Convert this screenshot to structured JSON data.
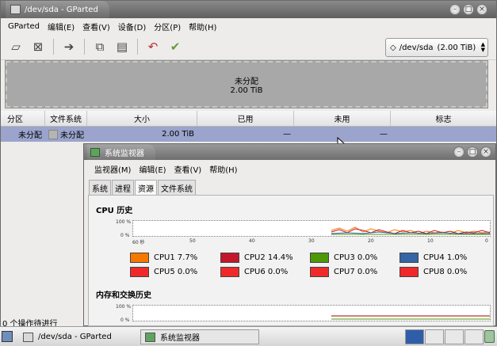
{
  "gparted": {
    "title": "/dev/sda - GParted",
    "menu": [
      "GParted",
      "编辑(E)",
      "查看(V)",
      "设备(D)",
      "分区(P)",
      "帮助(H)"
    ],
    "device_label": "/dev/sda",
    "device_size": "(2.00 TiB)",
    "map_label": "未分配",
    "map_size": "2.00 TiB",
    "columns": [
      "分区",
      "文件系统",
      "大小",
      "已用",
      "未用",
      "标志"
    ],
    "row": {
      "partition": "未分配",
      "filesystem": "未分配",
      "size": "2.00 TiB",
      "used": "—",
      "unused": "—",
      "flags": ""
    },
    "status": "0 个操作待进行"
  },
  "sysmon": {
    "title": "系统监视器",
    "menu": [
      "监视器(M)",
      "编辑(E)",
      "查看(V)",
      "帮助(H)"
    ],
    "tabs": [
      "系统",
      "进程",
      "资源",
      "文件系统"
    ],
    "active_tab": "资源",
    "cpu_heading": "CPU 历史",
    "mem_heading": "内存和交换历史",
    "y_labels": [
      "100 %",
      "0 %"
    ],
    "x_labels": [
      "60 秒",
      "50",
      "40",
      "30",
      "20",
      "10",
      "0"
    ],
    "cpus": [
      {
        "label": "CPU1",
        "value": "7.7%",
        "color": "#f57900"
      },
      {
        "label": "CPU2",
        "value": "14.4%",
        "color": "#c4172c"
      },
      {
        "label": "CPU3",
        "value": "0.0%",
        "color": "#4e9a06"
      },
      {
        "label": "CPU4",
        "value": "1.0%",
        "color": "#3465a4"
      },
      {
        "label": "CPU5",
        "value": "0.0%",
        "color": "#ef2929"
      },
      {
        "label": "CPU6",
        "value": "0.0%",
        "color": "#ef2929"
      },
      {
        "label": "CPU7",
        "value": "0.0%",
        "color": "#ef2929"
      },
      {
        "label": "CPU8",
        "value": "0.0%",
        "color": "#ef2929"
      }
    ]
  },
  "taskbar": {
    "items": [
      "/dev/sda - GParted",
      "系统监视器"
    ]
  }
}
